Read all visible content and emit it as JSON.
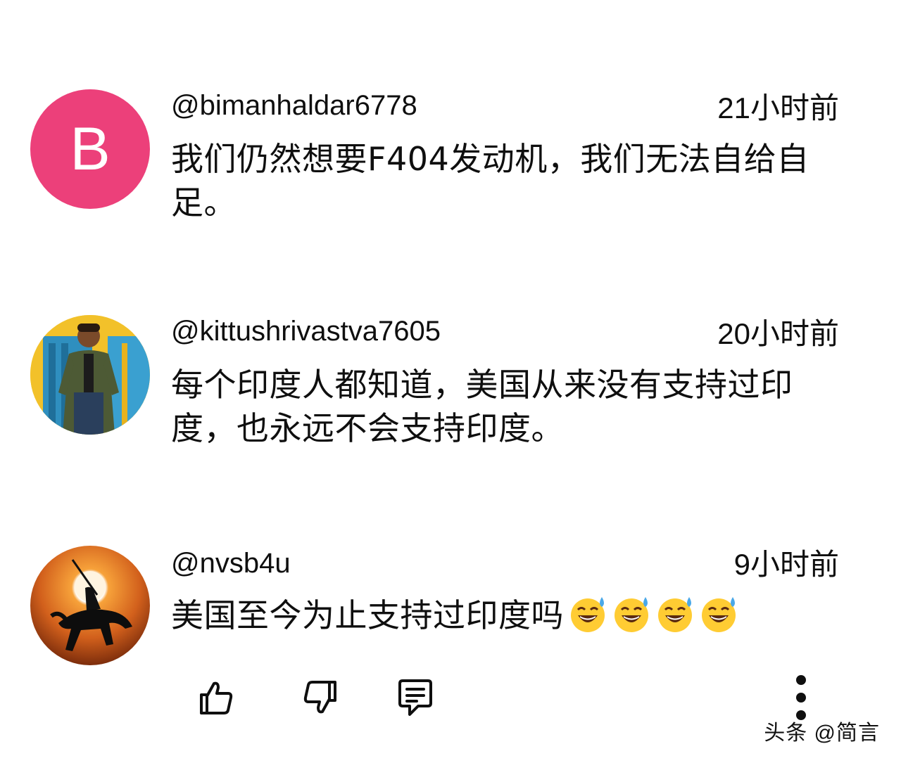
{
  "comments": [
    {
      "handle": "@bimanhaldar6778",
      "time": "21小时前",
      "text": "我们仍然想要F404发动机，我们无法自给自足。",
      "avatar": {
        "type": "letter",
        "letter": "B",
        "color": "#ec407a"
      }
    },
    {
      "handle": "@kittushrivastva7605",
      "time": "20小时前",
      "text": "每个印度人都知道，美国从来没有支持过印度，也永远不会支持印度。",
      "avatar": {
        "type": "photo",
        "icon": "person-photo-icon"
      }
    },
    {
      "handle": "@nvsb4u",
      "time": "9小时前",
      "text": "美国至今为止支持过印度吗",
      "emojis": [
        "grinning-sweat-emoji",
        "grinning-sweat-emoji",
        "grinning-sweat-emoji",
        "grinning-sweat-emoji"
      ],
      "avatar": {
        "type": "image",
        "icon": "horse-rider-sunset-icon"
      }
    }
  ],
  "actions": {
    "like_icon": "thumbs-up-icon",
    "dislike_icon": "thumbs-down-icon",
    "reply_icon": "reply-comment-icon",
    "more_icon": "more-vertical-icon"
  },
  "watermark": "头条 @简言"
}
